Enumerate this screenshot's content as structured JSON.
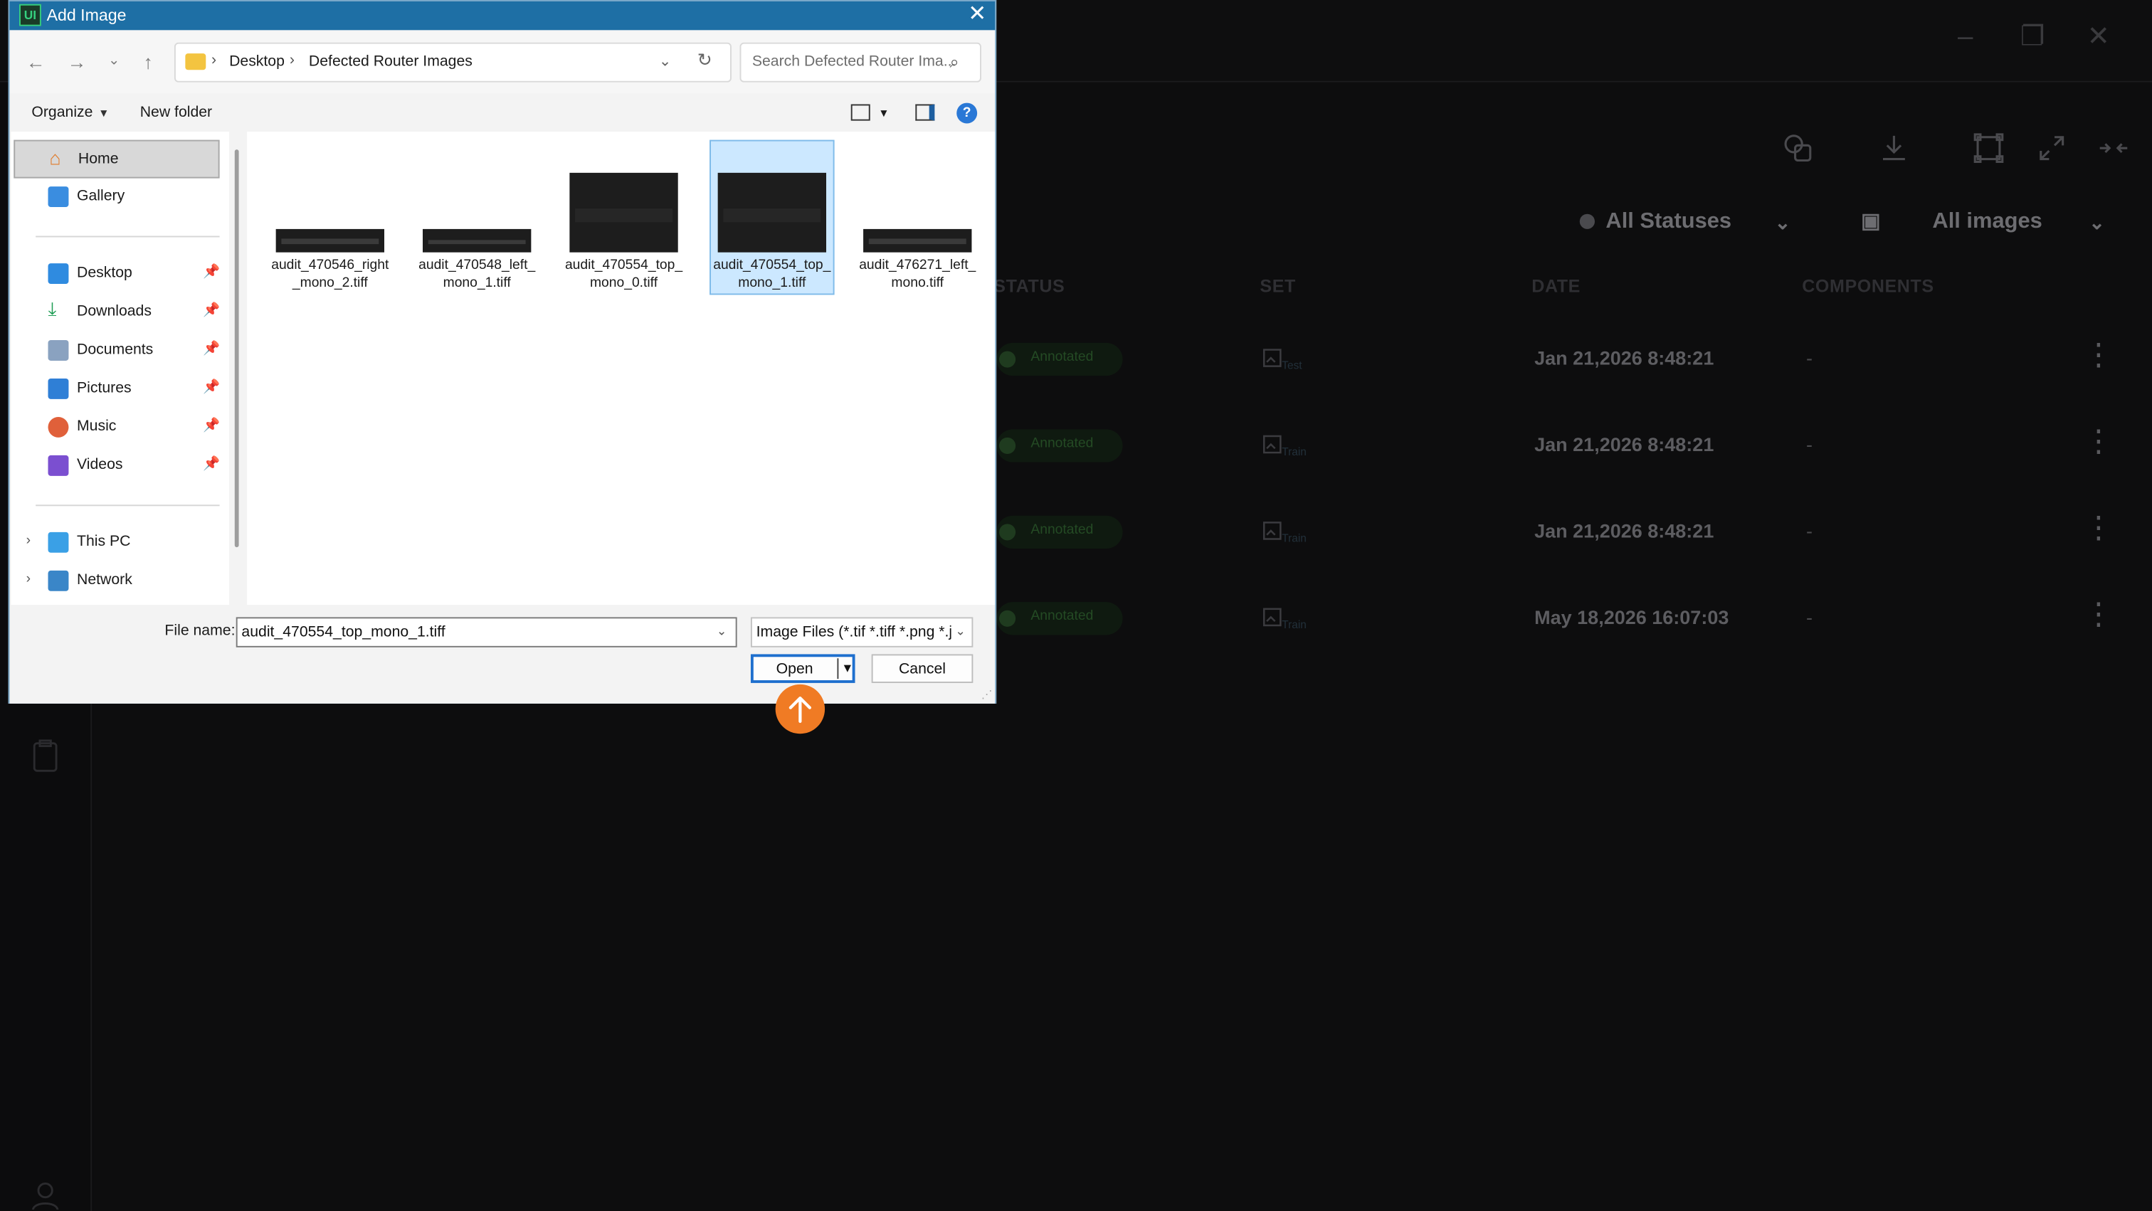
{
  "app": {
    "filters": {
      "status": "All Statuses",
      "images": "All images"
    },
    "columns": [
      "STATUS",
      "SET",
      "DATE",
      "COMPONENTS"
    ],
    "rows": [
      {
        "status": "Annotated",
        "set": "Test",
        "date": "Jan 21,2026 8:48:21",
        "components": "-"
      },
      {
        "status": "Annotated",
        "set": "Train",
        "date": "Jan 21,2026 8:48:21",
        "components": "-"
      },
      {
        "status": "Annotated",
        "set": "Train",
        "date": "Jan 21,2026 8:48:21",
        "components": "-"
      },
      {
        "status": "Annotated",
        "set": "Train",
        "date": "May 18,2026 16:07:03",
        "components": "-"
      }
    ],
    "toolbar_icons": [
      "compare-icon",
      "download-icon",
      "crop-icon",
      "expand-icon",
      "collapse-icon"
    ],
    "colors": {
      "background": "#0c0c0d",
      "annotated": "#1f3b1f"
    }
  },
  "dialog": {
    "title": "Add Image",
    "app_logo": "UI",
    "breadcrumb": [
      "Desktop",
      "Defected Router Images"
    ],
    "search_placeholder": "Search Defected Router Ima...",
    "commands": {
      "organize": "Organize",
      "new_folder": "New folder"
    },
    "nav_items": [
      {
        "label": "Home",
        "icon": "home-icon",
        "selected": true
      },
      {
        "label": "Gallery",
        "icon": "gallery-icon"
      },
      {
        "label": "Desktop",
        "icon": "desktop-icon",
        "pinned": true
      },
      {
        "label": "Downloads",
        "icon": "download-icon",
        "pinned": true
      },
      {
        "label": "Documents",
        "icon": "documents-icon",
        "pinned": true
      },
      {
        "label": "Pictures",
        "icon": "pictures-icon",
        "pinned": true
      },
      {
        "label": "Music",
        "icon": "music-icon",
        "pinned": true
      },
      {
        "label": "Videos",
        "icon": "videos-icon",
        "pinned": true
      },
      {
        "label": "This PC",
        "icon": "pc-icon"
      },
      {
        "label": "Network",
        "icon": "network-icon"
      }
    ],
    "files": [
      {
        "name": "audit_470546_right_mono_2.tiff",
        "selected": false
      },
      {
        "name": "audit_470548_left_mono_1.tiff",
        "selected": false
      },
      {
        "name": "audit_470554_top_mono_0.tiff",
        "selected": false
      },
      {
        "name": "audit_470554_top_mono_1.tiff",
        "selected": true
      },
      {
        "name": "audit_476271_left_mono.tiff",
        "selected": false
      }
    ],
    "file_name_label": "File name:",
    "file_name_value": "audit_470554_top_mono_1.tiff",
    "file_type": "Image Files (*.tif *.tiff *.png *.jp",
    "open_label": "Open",
    "cancel_label": "Cancel",
    "accent": "#1e6fa5"
  }
}
